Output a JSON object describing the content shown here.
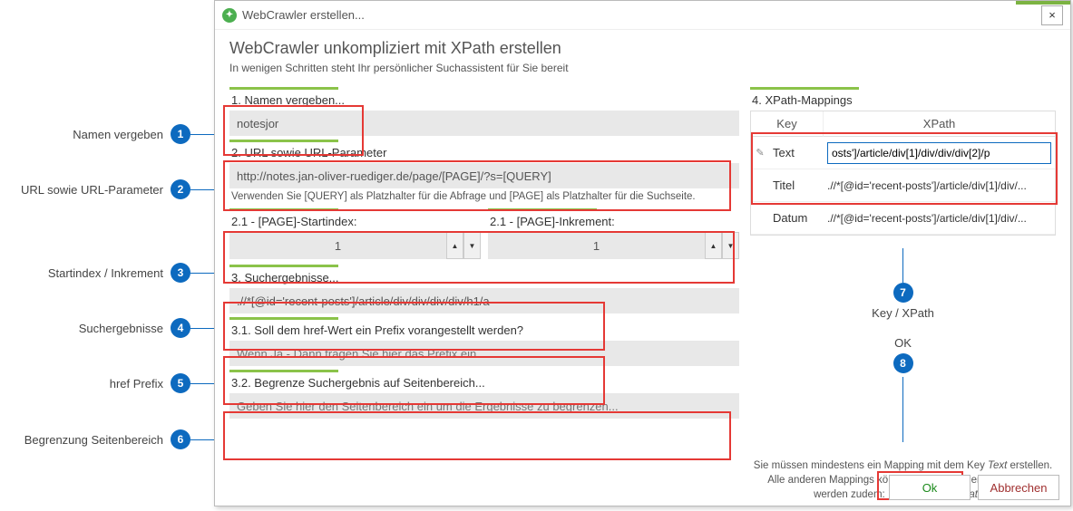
{
  "annotations": {
    "a1": {
      "label": "Namen vergeben",
      "num": "1"
    },
    "a2": {
      "label": "URL sowie URL-Parameter",
      "num": "2"
    },
    "a3": {
      "label": "Startindex / Inkrement",
      "num": "3"
    },
    "a4": {
      "label": "Suchergebnisse",
      "num": "4"
    },
    "a5": {
      "label": "href Prefix",
      "num": "5"
    },
    "a6": {
      "label": "Begrenzung Seitenbereich",
      "num": "6"
    },
    "a7": {
      "label": "Key / XPath",
      "num": "7"
    },
    "a8": {
      "label": "OK",
      "num": "8"
    }
  },
  "dialog": {
    "title": "WebCrawler erstellen...",
    "close": "×",
    "heading": "WebCrawler unkompliziert mit XPath erstellen",
    "subheading": "In wenigen Schritten steht Ihr persönlicher Suchassistent für Sie bereit"
  },
  "section1": {
    "label": "1. Namen vergeben...",
    "value": "notesjor"
  },
  "section2": {
    "label": "2. URL sowie URL-Parameter",
    "value": "http://notes.jan-oliver-ruediger.de/page/[PAGE]/?s=[QUERY]",
    "hint": "Verwenden Sie [QUERY] als Platzhalter für die Abfrage und [PAGE] als Platzhalter für die Suchseite."
  },
  "section21": {
    "label_start": "2.1 - [PAGE]-Startindex:",
    "val_start": "1",
    "label_inc": "2.1 - [PAGE]-Inkrement:",
    "val_inc": "1"
  },
  "section3": {
    "label": "3. Suchergebnisse...",
    "value": ".//*[@id='recent-posts']/article/div/div/div/div/h1/a"
  },
  "section31": {
    "label": "3.1. Soll dem href-Wert ein Prefix vorangestellt werden?",
    "placeholder": "Wenn Ja - Dann tragen Sie hier das Prefix ein..."
  },
  "section32": {
    "label": "3.2. Begrenze Suchergebnis auf Seitenbereich...",
    "placeholder": "Geben Sie hier den Seitenbereich ein um die Ergebnisse zu begrenzen..."
  },
  "mappings": {
    "label": "4. XPath-Mappings",
    "head_key": "Key",
    "head_xp": "XPath",
    "rows": [
      {
        "key": "Text",
        "xp": "osts']/article/div[1]/div/div/div[2]/p",
        "editing": true
      },
      {
        "key": "Titel",
        "xp": ".//*[@id='recent-posts']/article/div[1]/div/..."
      },
      {
        "key": "Datum",
        "xp": ".//*[@id='recent-posts']/article/div[1]/div/..."
      }
    ],
    "note": "Sie müssen mindestens ein Mapping mit dem Key Text erstellen. Alle anderen Mappings können Sie frei wählen. Empfohlen werden zudem: Titel, Autor und Datum"
  },
  "buttons": {
    "ok": "Ok",
    "cancel": "Abbrechen"
  }
}
